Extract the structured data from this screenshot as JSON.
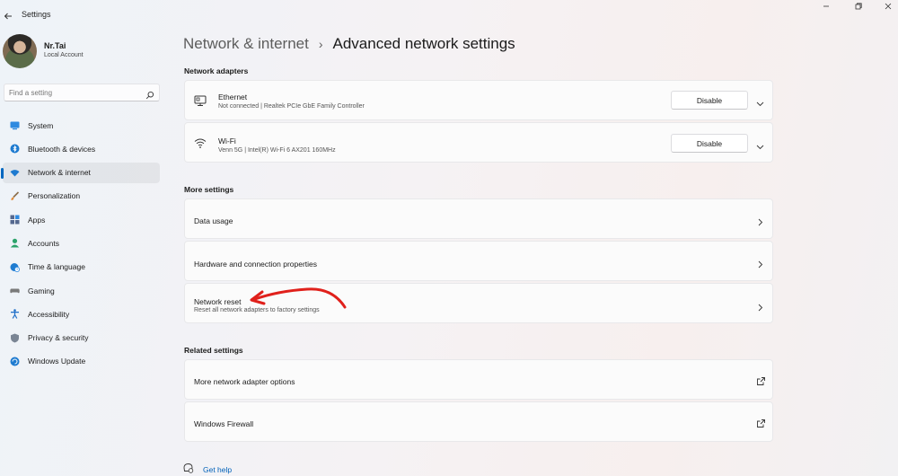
{
  "window": {
    "title": "Settings"
  },
  "user": {
    "name": "Nr.Tai",
    "account_type": "Local Account"
  },
  "search": {
    "placeholder": "Find a setting"
  },
  "sidebar": {
    "items": [
      {
        "label": "System",
        "icon": "system-icon",
        "color": "#1e7bd0"
      },
      {
        "label": "Bluetooth & devices",
        "icon": "bluetooth-icon",
        "color": "#1e7bd0"
      },
      {
        "label": "Network & internet",
        "icon": "wifi-icon",
        "color": "#1e7bd0"
      },
      {
        "label": "Personalization",
        "icon": "brush-icon",
        "color": "#d98a3a"
      },
      {
        "label": "Apps",
        "icon": "apps-icon",
        "color": "#4a5d8a"
      },
      {
        "label": "Accounts",
        "icon": "person-icon",
        "color": "#2ca36b"
      },
      {
        "label": "Time & language",
        "icon": "globe-clock-icon",
        "color": "#1e7bd0"
      },
      {
        "label": "Gaming",
        "icon": "gamepad-icon",
        "color": "#7a7a7a"
      },
      {
        "label": "Accessibility",
        "icon": "accessibility-icon",
        "color": "#1e6ec8"
      },
      {
        "label": "Privacy & security",
        "icon": "shield-icon",
        "color": "#7a8594"
      },
      {
        "label": "Windows Update",
        "icon": "update-icon",
        "color": "#1e7bd0"
      }
    ],
    "active_index": 2
  },
  "breadcrumb": {
    "parent": "Network & internet",
    "separator": "›",
    "current": "Advanced network settings"
  },
  "adapters": {
    "title": "Network adapters",
    "items": [
      {
        "name": "Ethernet",
        "detail": "Not connected | Realtek PCIe GbE Family Controller",
        "button": "Disable",
        "icon": "ethernet-icon"
      },
      {
        "name": "Wi-Fi",
        "detail": "Venn 5G | Intel(R) Wi-Fi 6 AX201 160MHz",
        "button": "Disable",
        "icon": "wifi-icon"
      }
    ]
  },
  "more_settings": {
    "title": "More settings",
    "items": [
      {
        "label": "Data usage"
      },
      {
        "label": "Hardware and connection properties"
      },
      {
        "label": "Network reset",
        "sub": "Reset all network adapters to factory settings"
      }
    ]
  },
  "related_settings": {
    "title": "Related settings",
    "items": [
      {
        "label": "More network adapter options"
      },
      {
        "label": "Windows Firewall"
      }
    ]
  },
  "help": {
    "label": "Get help"
  },
  "colors": {
    "accent": "#0067c0",
    "link": "#0060b8",
    "annotation": "#e0201b"
  }
}
